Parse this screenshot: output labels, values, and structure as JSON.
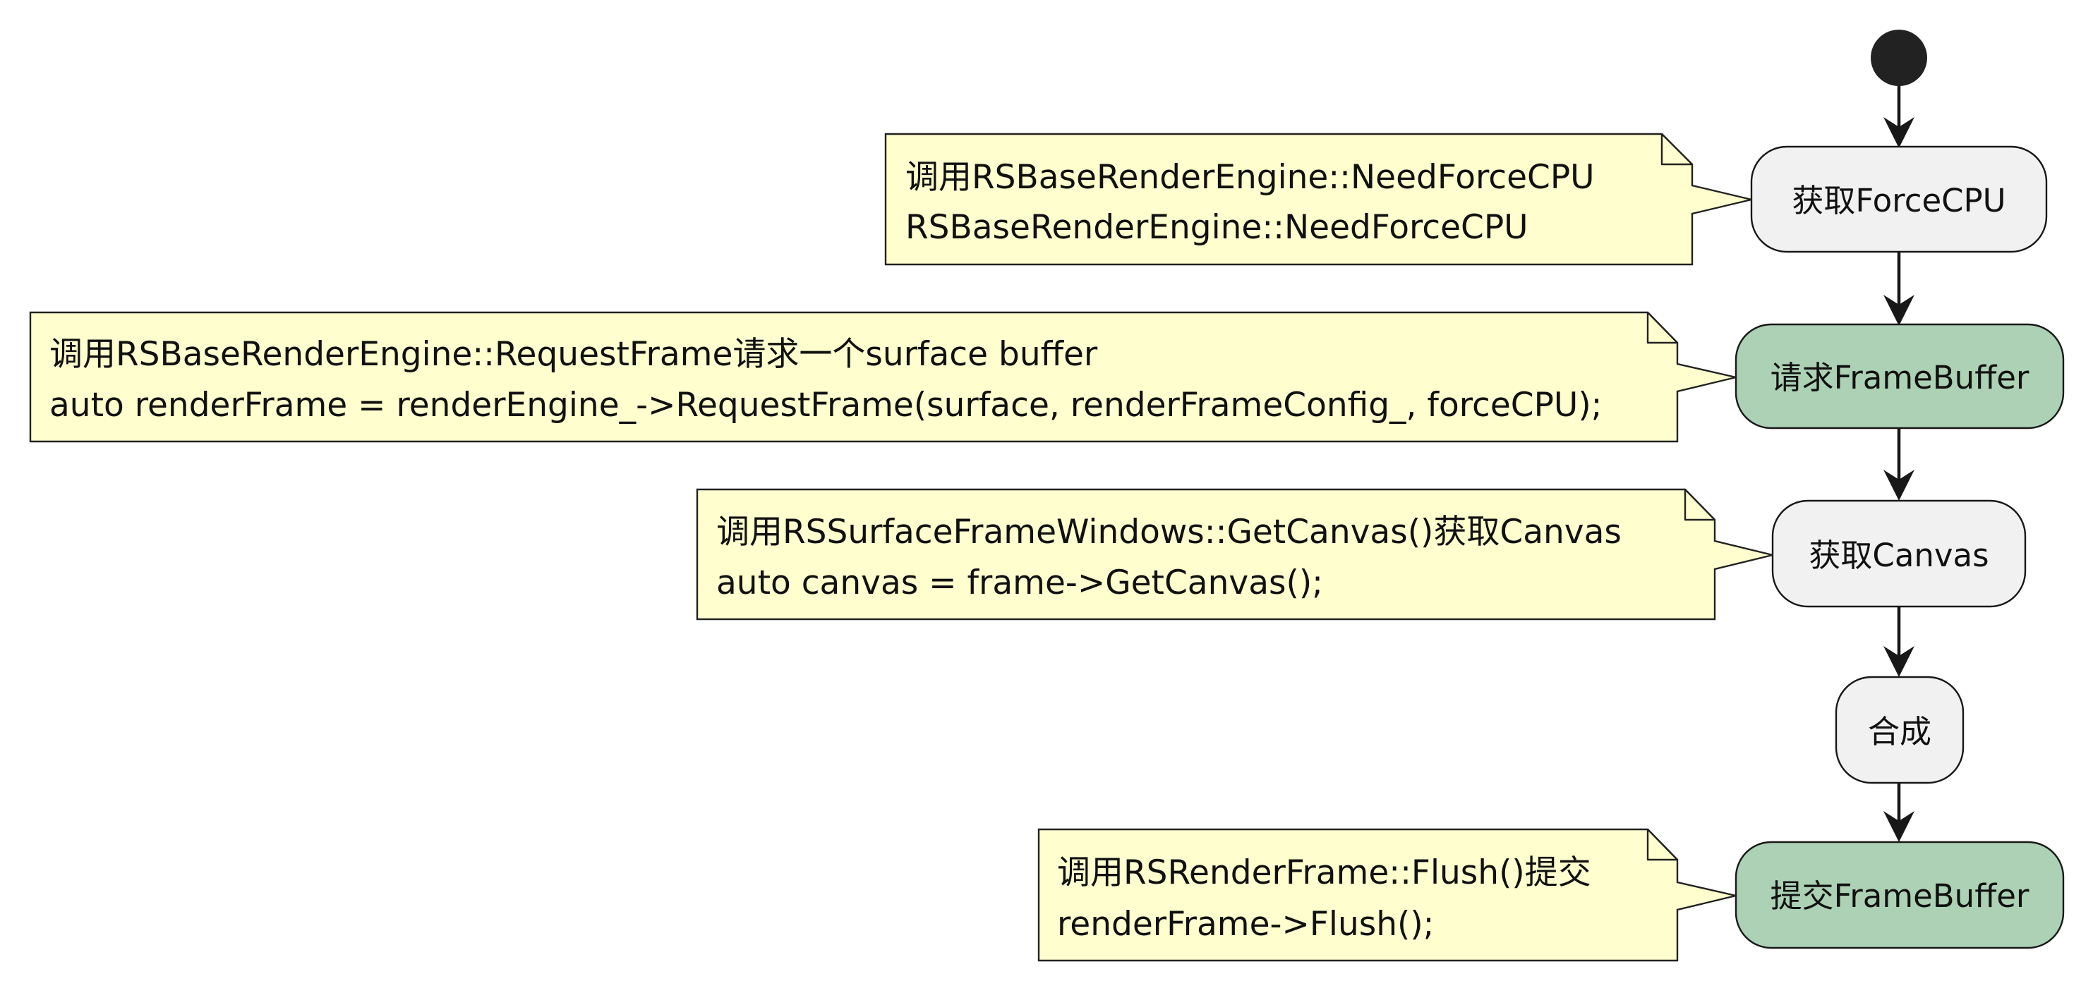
{
  "colors": {
    "node_default": "#f1f1f1",
    "node_highlight": "#acd1b4",
    "note_fill": "#fefece",
    "start_node": "#222222",
    "line": "#181818"
  },
  "steps": [
    {
      "id": "get-force-cpu",
      "label": "获取ForceCPU",
      "highlight": false,
      "note": {
        "line1": "调用RSBaseRenderEngine::NeedForceCPU",
        "line2": "RSBaseRenderEngine::NeedForceCPU"
      }
    },
    {
      "id": "request-framebuffer",
      "label": "请求FrameBuffer",
      "highlight": true,
      "note": {
        "line1": "调用RSBaseRenderEngine::RequestFrame请求一个surface buffer",
        "line2": "auto renderFrame = renderEngine_->RequestFrame(surface, renderFrameConfig_, forceCPU);"
      }
    },
    {
      "id": "get-canvas",
      "label": "获取Canvas",
      "highlight": false,
      "note": {
        "line1": "调用RSSurfaceFrameWindows::GetCanvas()获取Canvas",
        "line2": "auto canvas = frame->GetCanvas();"
      }
    },
    {
      "id": "compose",
      "label": "合成",
      "highlight": false,
      "note": null
    },
    {
      "id": "submit-framebuffer",
      "label": "提交FrameBuffer",
      "highlight": true,
      "note": {
        "line1": "调用RSRenderFrame::Flush()提交",
        "line2": "renderFrame->Flush();"
      }
    }
  ]
}
